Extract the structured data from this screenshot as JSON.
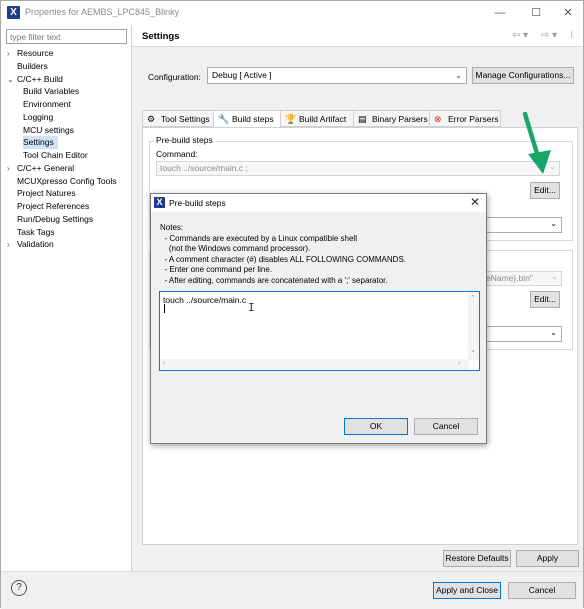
{
  "window": {
    "title": "Properties for AEMBS_LPC845_Blinky",
    "minimize": "—",
    "maximize": "☐",
    "close": "✕"
  },
  "left_panel": {
    "filter_placeholder": "type filter text",
    "tree": [
      {
        "label": "Resource",
        "arrow": "›",
        "indent": 0
      },
      {
        "label": "Builders",
        "arrow": "",
        "indent": 0
      },
      {
        "label": "C/C++ Build",
        "arrow": "⌄",
        "indent": 0
      },
      {
        "label": "Build Variables",
        "arrow": "",
        "indent": 1
      },
      {
        "label": "Environment",
        "arrow": "",
        "indent": 1
      },
      {
        "label": "Logging",
        "arrow": "",
        "indent": 1
      },
      {
        "label": "MCU settings",
        "arrow": "",
        "indent": 1
      },
      {
        "label": "Settings",
        "arrow": "",
        "indent": 1,
        "selected": true
      },
      {
        "label": "Tool Chain Editor",
        "arrow": "",
        "indent": 1
      },
      {
        "label": "C/C++ General",
        "arrow": "›",
        "indent": 0
      },
      {
        "label": "MCUXpresso Config Tools",
        "arrow": "",
        "indent": 0
      },
      {
        "label": "Project Natures",
        "arrow": "",
        "indent": 0
      },
      {
        "label": "Project References",
        "arrow": "",
        "indent": 0
      },
      {
        "label": "Run/Debug Settings",
        "arrow": "",
        "indent": 0
      },
      {
        "label": "Task Tags",
        "arrow": "",
        "indent": 0
      },
      {
        "label": "Validation",
        "arrow": "›",
        "indent": 0
      }
    ]
  },
  "settings": {
    "title": "Settings",
    "nav_back": "⇦ ▾",
    "nav_fwd": "⇨ ▾",
    "nav_menu": "⁝",
    "configuration_label": "Configuration:",
    "configuration_value": "Debug  [ Active ]",
    "manage_button": "Manage Configurations...",
    "tabs": [
      {
        "label": "Tool Settings",
        "icon": "⚙",
        "active": false
      },
      {
        "label": "Build steps",
        "icon": "🔧",
        "active": true
      },
      {
        "label": "Build Artifact",
        "icon": "🏆",
        "active": false
      },
      {
        "label": "Binary Parsers",
        "icon": "▤",
        "active": false
      },
      {
        "label": "Error Parsers",
        "icon": "⊗",
        "active": false
      }
    ],
    "prebuild_group": "Pre-build steps",
    "command_label": "Command:",
    "command_value": "touch ../source/main.c ;",
    "edit_button": "Edit...",
    "postbuild_partial_value": "aseName}.bin\"",
    "edit_button_2": "Edit...",
    "restore_defaults": "Restore Defaults",
    "apply": "Apply"
  },
  "footer": {
    "help": "?",
    "apply_close": "Apply and Close",
    "cancel": "Cancel"
  },
  "dialog": {
    "title": "Pre-build steps",
    "close": "✕",
    "notes": [
      "Notes:",
      "  - Commands are executed by a Linux compatible shell",
      "    (not the Windows command processor).",
      "  - A comment character (#) disables ALL FOLLOWING COMMANDS.",
      "  - Enter one command per line.",
      "  - After editing, commands are concatenated with a ';' separator."
    ],
    "command_text": "touch ../source/main.c",
    "ok": "OK",
    "cancel": "Cancel"
  },
  "colors": {
    "accent": "#0078d7",
    "selection": "#cce4f7",
    "arrow_green": "#1aa56b"
  }
}
